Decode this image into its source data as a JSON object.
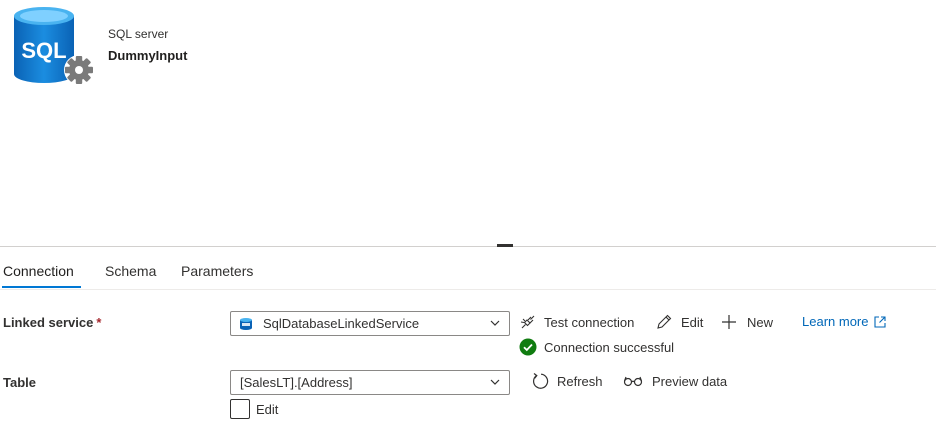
{
  "dataset": {
    "type_label": "SQL server",
    "name": "DummyInput",
    "icon": "sql-database-gear-icon",
    "icon_text": "SQL"
  },
  "tabs": [
    {
      "label": "Connection",
      "active": true
    },
    {
      "label": "Schema",
      "active": false
    },
    {
      "label": "Parameters",
      "active": false
    }
  ],
  "linked_service": {
    "label": "Linked service",
    "required_marker": "*",
    "value": "SqlDatabaseLinkedService",
    "actions": {
      "test_connection": "Test connection",
      "edit": "Edit",
      "new": "New",
      "learn_more": "Learn more"
    },
    "status": "Connection successful",
    "status_color": "#107c10"
  },
  "table": {
    "label": "Table",
    "value": "[SalesLT].[Address]",
    "actions": {
      "refresh": "Refresh",
      "preview": "Preview data"
    },
    "edit_checkbox": {
      "label": "Edit",
      "checked": false
    }
  },
  "colors": {
    "accent": "#0078d4",
    "link": "#0067b8",
    "required": "#a4262c"
  }
}
